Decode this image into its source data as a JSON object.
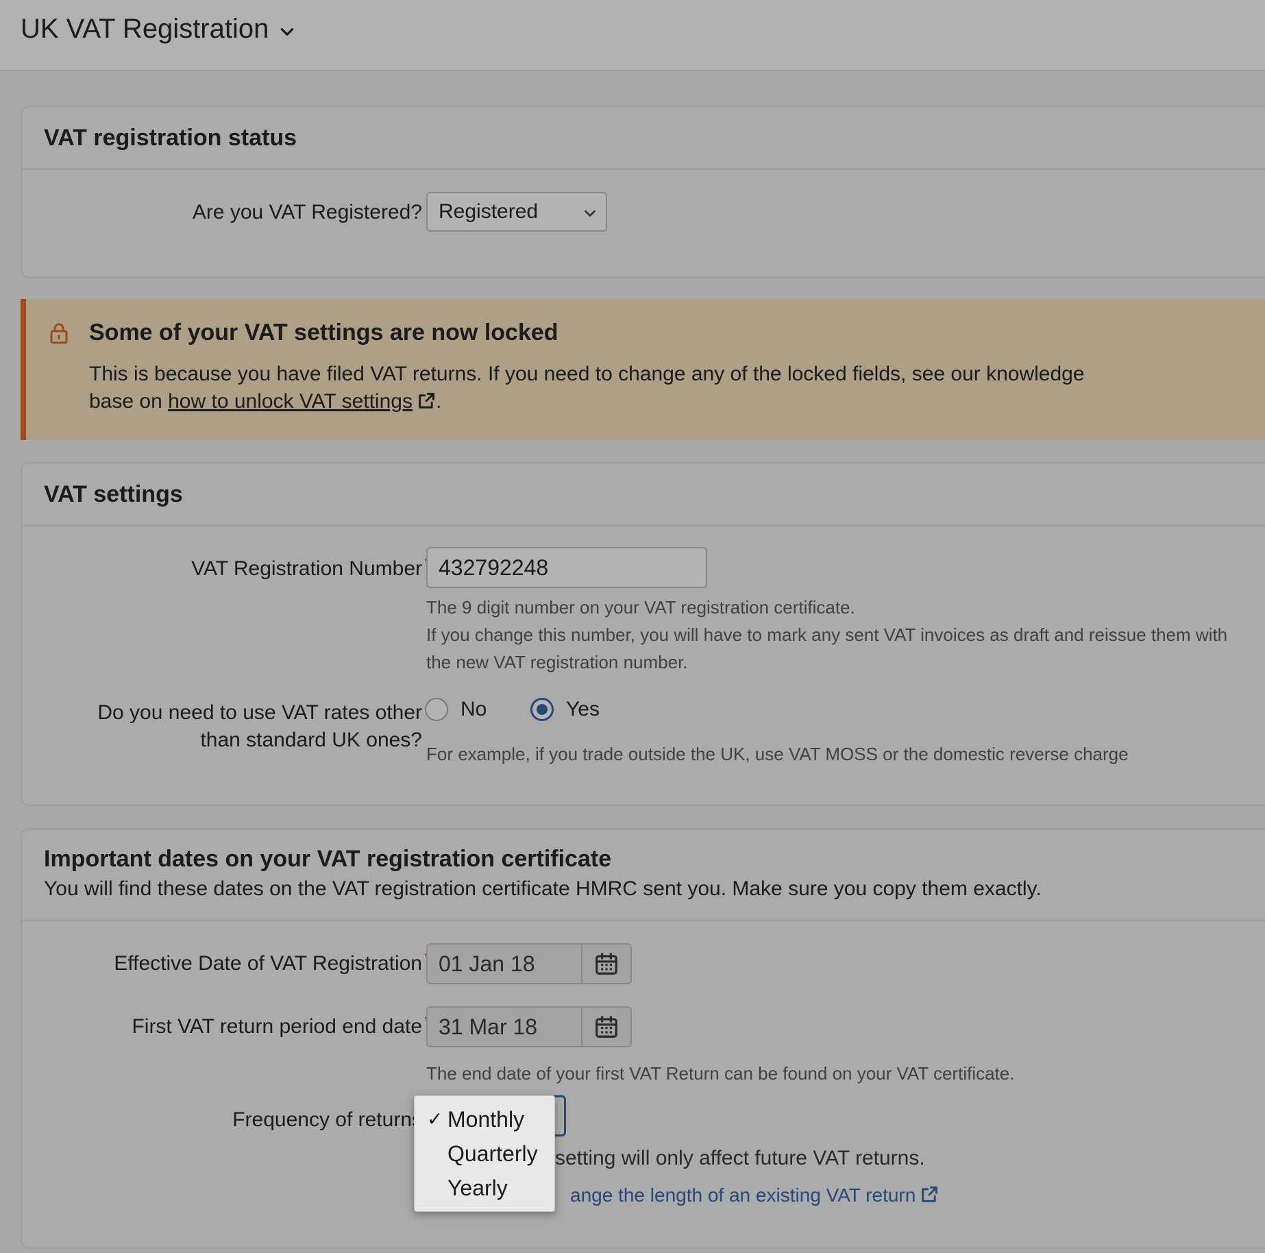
{
  "header": {
    "title": "UK VAT Registration"
  },
  "registration_status": {
    "title": "VAT registration status",
    "question": "Are you VAT Registered?",
    "selected": "Registered"
  },
  "alert": {
    "title": "Some of your VAT settings are now locked",
    "body_line1": "This is because you have filed VAT returns. If you need to change any of the locked fields, see our knowledge",
    "body_prefix": "base on",
    "link": "how to unlock VAT settings",
    "body_suffix": "."
  },
  "vat_settings": {
    "title": "VAT settings",
    "number_label": "VAT Registration Number",
    "number_value": "432792248",
    "number_help1": "The 9 digit number on your VAT registration certificate.",
    "number_help2": "If you change this number, you will have to mark any sent VAT invoices as draft and reissue them with",
    "number_help3": "the new VAT registration number.",
    "rates_label1": "Do you need to use VAT rates other",
    "rates_label2": "than standard UK ones?",
    "option_no": "No",
    "option_yes": "Yes",
    "selected_option": "Yes",
    "rates_help": "For example, if you trade outside the UK, use VAT MOSS or the domestic reverse charge"
  },
  "dates": {
    "title": "Important dates on your VAT registration certificate",
    "subtitle": "You will find these dates on the VAT registration certificate HMRC sent you. Make sure you copy them exactly.",
    "effective_label": "Effective Date of VAT Registration",
    "effective_value": "01 Jan 18",
    "first_return_label": "First VAT return period end date",
    "first_return_value": "31 Mar 18",
    "first_return_help": "The end date of your first VAT Return can be found on your VAT certificate.",
    "frequency_label": "Frequency of returns",
    "frequency_help_visible": "setting will only affect future VAT returns.",
    "frequency_link_visible": "ange the length of an existing VAT return"
  },
  "frequency_menu": {
    "check": "✓",
    "options": [
      "Monthly",
      "Quarterly",
      "Yearly"
    ],
    "selected": "Monthly"
  },
  "icons": [
    "chevron-down-icon",
    "lock-icon",
    "external-link-icon",
    "calendar-icon"
  ],
  "colors": {
    "accent": "#26497a",
    "required": "#8b1e1e",
    "alert_border": "#a24a16",
    "alert_bg": "#ae9f87"
  }
}
